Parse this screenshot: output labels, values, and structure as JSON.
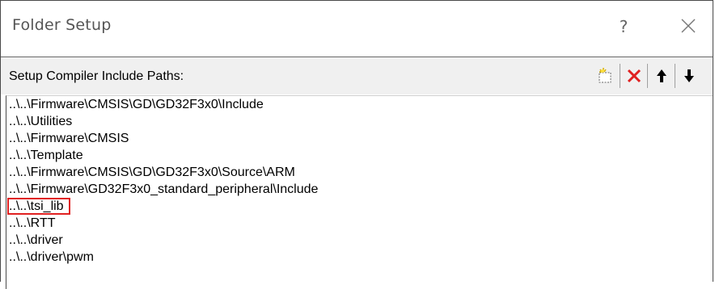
{
  "dialog": {
    "title": "Folder Setup",
    "help_label": "?"
  },
  "section": {
    "label": "Setup Compiler Include Paths:",
    "toolbar": [
      {
        "name": "new-folder-button",
        "icon": "new-folder-icon"
      },
      {
        "name": "delete-button",
        "icon": "red-x-icon"
      },
      {
        "name": "move-up-button",
        "icon": "arrow-up-icon"
      },
      {
        "name": "move-down-button",
        "icon": "arrow-down-icon"
      }
    ]
  },
  "paths": {
    "items": [
      "..\\..\\Firmware\\CMSIS\\GD\\GD32F3x0\\Include",
      "..\\..\\Utilities",
      "..\\..\\Firmware\\CMSIS",
      "..\\..\\Template",
      "..\\..\\Firmware\\CMSIS\\GD\\GD32F3x0\\Source\\ARM",
      "..\\..\\Firmware\\GD32F3x0_standard_peripheral\\Include",
      "..\\..\\tsi_lib",
      "..\\..\\RTT",
      "..\\..\\driver",
      "..\\..\\driver\\pwm"
    ],
    "highlighted_index": 6
  },
  "colors": {
    "highlight": "#e02020",
    "delete": "#e02020",
    "header_bg": "#f0f0f0"
  }
}
